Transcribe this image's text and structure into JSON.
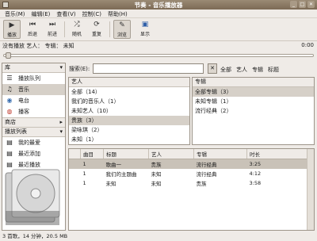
{
  "window": {
    "title": "节奏 - 音乐播放器"
  },
  "menu": [
    "音乐(M)",
    "编辑(E)",
    "查看(V)",
    "控制(C)",
    "帮助(H)"
  ],
  "toolbar": {
    "prev": "后退",
    "play": "播放",
    "next": "前进",
    "shuffle": "随机",
    "repeat": "重复",
    "browse": "浏览",
    "visual": "显示"
  },
  "now_playing": {
    "text": "没有播放 艺人：  专辑：  未知",
    "time": "0:00"
  },
  "sidebar": {
    "header": "库",
    "items": [
      {
        "label": "播放队列",
        "icon": "queue-icon"
      },
      {
        "label": "音乐",
        "icon": "music-icon"
      },
      {
        "label": "电台",
        "icon": "radio-icon"
      },
      {
        "label": "播客",
        "icon": "podcast-icon"
      }
    ],
    "section_stores": "商店",
    "section_playlists": "播放列表",
    "playlist_items": [
      "我的最爱",
      "最近添加",
      "最近播放"
    ]
  },
  "filter": {
    "label": "搜索(E):",
    "options": [
      "全部",
      "艺人",
      "专辑",
      "标题"
    ]
  },
  "artist_pane": {
    "header": "艺人",
    "rows": [
      "全部（14）",
      "我们的音乐人（1）",
      "未知艺人（10）",
      "贵族（3）",
      "梁咏琪（2）",
      "未知（1）"
    ]
  },
  "album_pane": {
    "header": "专辑",
    "rows": [
      "全部专辑（3）",
      "未知专辑（1）",
      "流行经典（2）"
    ]
  },
  "tracks": {
    "columns": [
      "",
      "曲目",
      "标题",
      "艺人",
      "专辑",
      "时长"
    ],
    "rows": [
      {
        "playing": "",
        "num": "1",
        "title": "歌曲一",
        "artist": "贵族",
        "album": "流行经典",
        "time": "3:25"
      },
      {
        "playing": "",
        "num": "1",
        "title": "我们的主题曲",
        "artist": "未知",
        "album": "流行经典",
        "time": "4:12"
      },
      {
        "playing": "",
        "num": "1",
        "title": "未知",
        "artist": "未知",
        "album": "贵族",
        "time": "3:58"
      }
    ]
  },
  "status": "3 首歌，14 分钟，20.5 MB",
  "colors": {
    "titlebar": "#8a7a65",
    "selection": "#d6d0c8",
    "window_bg": "#efebe7"
  }
}
